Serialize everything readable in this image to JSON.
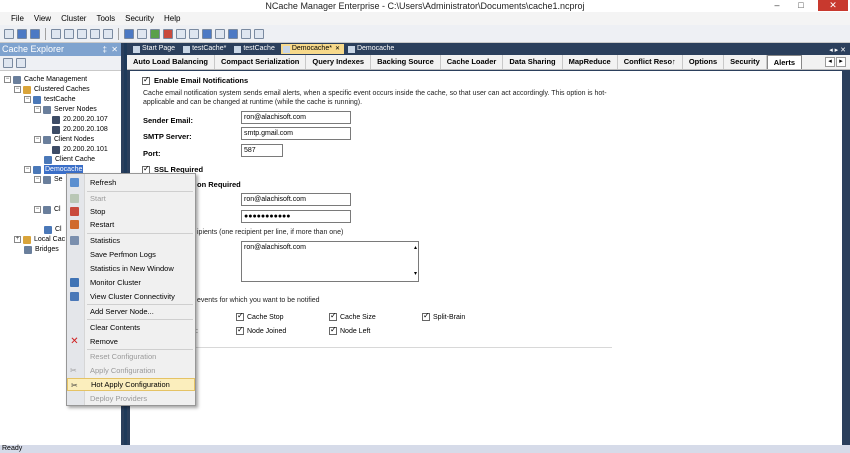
{
  "window": {
    "title": "NCache Manager Enterprise - C:\\Users\\Administrator\\Documents\\cache1.ncproj"
  },
  "menu": [
    "File",
    "View",
    "Cluster",
    "Tools",
    "Security",
    "Help"
  ],
  "explorer": {
    "title": "Cache Explorer",
    "pin_glyph": "‡",
    "close_glyph": "✕",
    "tree": {
      "cache_management": "Cache Management",
      "clustered_caches": "Clustered Caches",
      "test_cache": "testCache",
      "server_nodes": "Server Nodes",
      "server_node_1": "20.200.20.107",
      "server_node_2": "20.200.20.108",
      "client_nodes": "Client Nodes",
      "client_node_1": "20.200.20.101",
      "client_cache": "Client Cache",
      "demo_cache": "Democache",
      "demo_server_nodes_partial": "Se",
      "demo_client_nodes_partial": "Cl",
      "demo_client_cache_partial": "Cl",
      "demo_client_cache_partial2": "Cl",
      "local_caches": "Local Cac",
      "bridges": "Bridges"
    }
  },
  "doc_tabs": [
    "Start Page",
    "testCache*",
    "testCache",
    "Democache*",
    "Democache"
  ],
  "sub_tabs": [
    "Auto Load Balancing",
    "Compact Serialization",
    "Query Indexes",
    "Backing Source",
    "Cache Loader",
    "Data Sharing",
    "MapReduce",
    "Conflict Reso↑",
    "Options",
    "Security",
    "Alerts"
  ],
  "alerts": {
    "enable_label": "Enable Email Notifications",
    "description": "Cache email notification system sends email alerts, when a specific event occurs inside the cache, so that user can act accordingly. This option is hot-applicable and can be changed at runtime (while the cache is running).",
    "sender_label": "Sender Email:",
    "sender_value": "ron@alachisoft.com",
    "smtp_label": "SMTP Server:",
    "smtp_value": "smtp.gmail.com",
    "port_label": "Port:",
    "port_value": "587",
    "ssl_label": "SSL Required",
    "auth_label_partial": "on Required",
    "user_value": "ron@alachisoft.com",
    "password_value": "●●●●●●●●●●●",
    "recipients_hint": "ipients (one recipient per line, if more than one)",
    "recipients_value": "ron@alachisoft.com",
    "events_hint": "events for which you want to be notified",
    "events": [
      "Cache Stop",
      "Cache Size",
      "Split-Brain",
      "Node Joined",
      "Node Left"
    ],
    "events_partial_left": ":"
  },
  "context_menu": {
    "refresh": "Refresh",
    "start": "Start",
    "stop": "Stop",
    "restart": "Restart",
    "statistics": "Statistics",
    "save_perfmon": "Save Perfmon Logs",
    "stats_window": "Statistics in New Window",
    "monitor": "Monitor Cluster",
    "view_connectivity": "View Cluster Connectivity",
    "add_server": "Add Server Node...",
    "clear": "Clear Contents",
    "remove": "Remove",
    "reset_config": "Reset Configuration",
    "apply_config": "Apply Configuration",
    "hot_apply": "Hot Apply Configuration",
    "deploy": "Deploy Providers"
  },
  "status": {
    "text": "Ready"
  },
  "colors": {
    "explorer_header": "#7fa3cf",
    "workspace": "#2b3f5c",
    "active_doc_tab": "#f7d98a",
    "menu_highlight": "#fbeebd",
    "selection": "#3b6fc8"
  }
}
